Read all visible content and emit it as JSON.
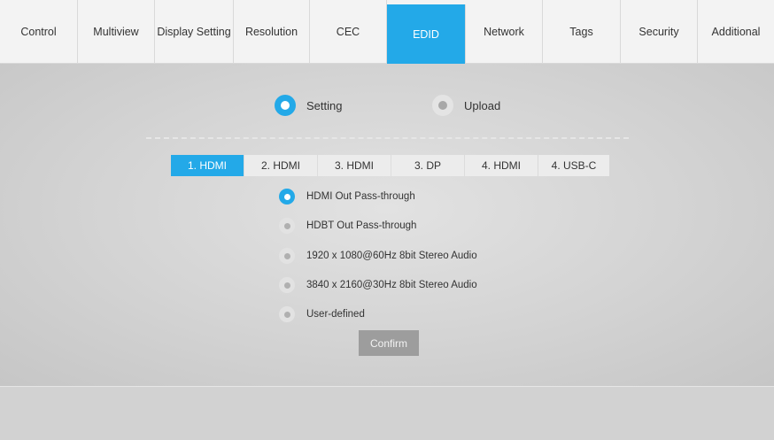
{
  "nav": {
    "tabs": [
      {
        "label": "Control"
      },
      {
        "label": "Multiview"
      },
      {
        "label": "Display Setting"
      },
      {
        "label": "Resolution"
      },
      {
        "label": "CEC"
      },
      {
        "label": "EDID",
        "active": true
      },
      {
        "label": "Network"
      },
      {
        "label": "Tags"
      },
      {
        "label": "Security"
      },
      {
        "label": "Additional"
      }
    ]
  },
  "mode": {
    "setting_label": "Setting",
    "upload_label": "Upload",
    "selected": "Setting"
  },
  "ports": {
    "tabs": [
      "1. HDMI",
      "2. HDMI",
      "3. HDMI",
      "3. DP",
      "4. HDMI",
      "4. USB-C"
    ],
    "selected": "1. HDMI"
  },
  "edid": {
    "options": [
      "HDMI Out Pass-through",
      "HDBT Out Pass-through",
      "1920 x 1080@60Hz 8bit Stereo Audio",
      "3840 x 2160@30Hz 8bit Stereo Audio",
      "User-defined"
    ],
    "selected": "HDMI Out Pass-through",
    "confirm_label": "Confirm"
  },
  "colors": {
    "accent": "#23a9e8",
    "nav_bg": "#f3f3f3",
    "panel_bg": "#d3d3d3",
    "confirm_bg": "#9d9d9d"
  }
}
